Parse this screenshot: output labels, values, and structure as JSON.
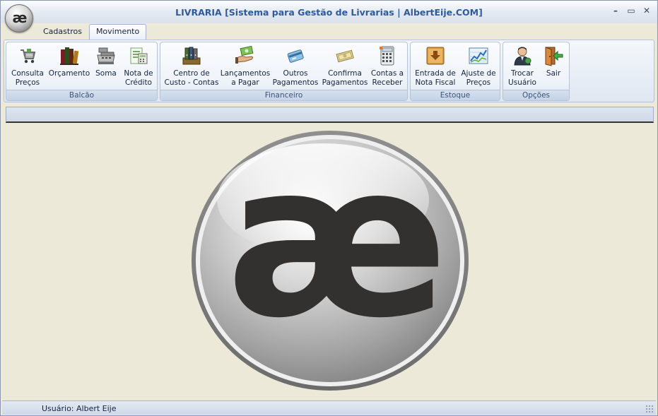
{
  "window": {
    "title": "LIVRARIA [Sistema para Gestão de Livrarias  |  AlbertEije.COM]",
    "app_icon_text": "æ",
    "controls": {
      "minimize": "–",
      "maximize": "▭",
      "close": "✕"
    }
  },
  "tabs": [
    {
      "label": "Cadastros",
      "active": false
    },
    {
      "label": "Movimento",
      "active": true
    }
  ],
  "ribbon": {
    "groups": {
      "balcao": {
        "label": "Balcão",
        "buttons": {
          "consulta_precos": {
            "label": "Consulta\nPreços",
            "icon": "shopping-cart-icon"
          },
          "orcamento": {
            "label": "Orçamento",
            "icon": "books-icon"
          },
          "soma": {
            "label": "Soma",
            "icon": "cash-register-icon"
          },
          "nota_credito": {
            "label": "Nota de\nCrédito",
            "icon": "credit-note-icon"
          }
        }
      },
      "financeiro": {
        "label": "Financeiro",
        "buttons": {
          "centro_custo": {
            "label": "Centro de\nCusto - Contas",
            "icon": "binders-icon"
          },
          "lancamentos": {
            "label": "Lançamentos\na Pagar",
            "icon": "money-hand-icon"
          },
          "outros_pagamentos": {
            "label": "Outros\nPagamentos",
            "icon": "credit-card-icon"
          },
          "confirma_pagamentos": {
            "label": "Confirma\nPagamentos",
            "icon": "banknote-icon"
          },
          "contas_receber": {
            "label": "Contas a\nReceber",
            "icon": "calculator-icon"
          }
        }
      },
      "estoque": {
        "label": "Estoque",
        "buttons": {
          "entrada_nota": {
            "label": "Entrada de\nNota Fiscal",
            "icon": "box-download-icon"
          },
          "ajuste_precos": {
            "label": "Ajuste de\nPreços",
            "icon": "chart-icon"
          }
        }
      },
      "opcoes": {
        "label": "Opções",
        "buttons": {
          "trocar_usuario": {
            "label": "Trocar\nUsuário",
            "icon": "user-icon"
          },
          "sair": {
            "label": "Sair",
            "icon": "exit-door-icon"
          }
        }
      }
    }
  },
  "logo": {
    "text": "æ"
  },
  "status": {
    "user": "Usuário: Albert Eije"
  }
}
